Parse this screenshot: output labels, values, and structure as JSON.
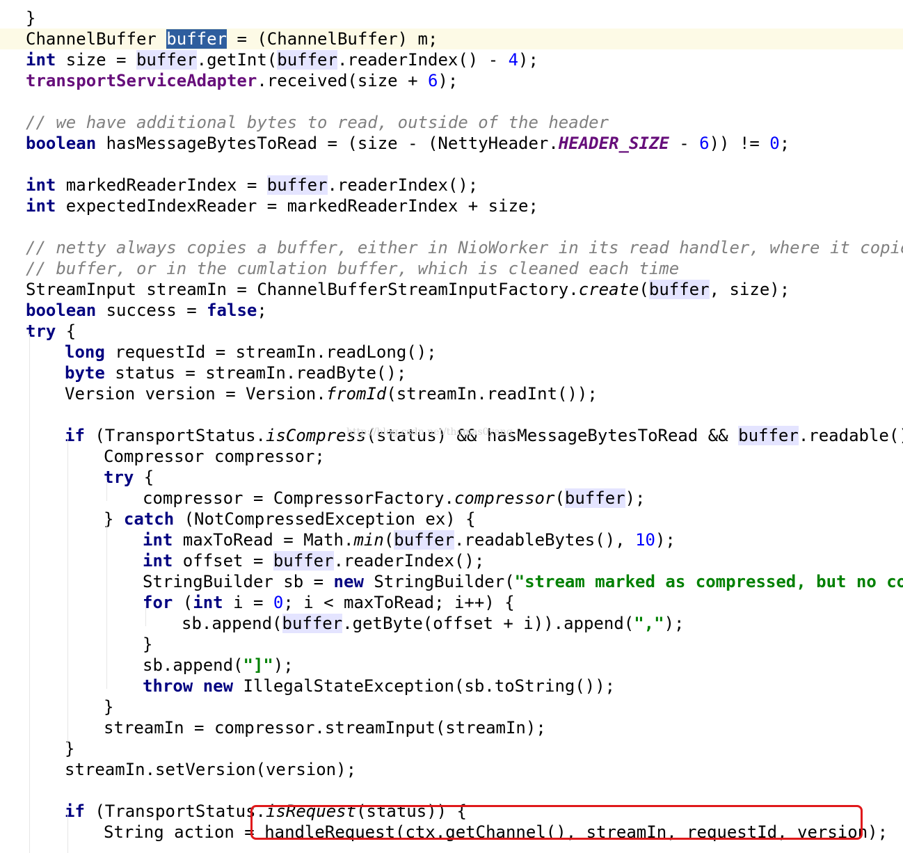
{
  "code_lines": [
    {
      "indent": 0,
      "tokens": [
        {
          "t": "}",
          "c": ""
        }
      ]
    },
    {
      "indent": 0,
      "current": true,
      "tokens": [
        {
          "t": "ChannelBuffer ",
          "c": ""
        },
        {
          "t": "buffer",
          "c": "sel"
        },
        {
          "t": " = (ChannelBuffer) m;",
          "c": ""
        }
      ]
    },
    {
      "indent": 0,
      "tokens": [
        {
          "t": "int",
          "c": "k"
        },
        {
          "t": " size = ",
          "c": ""
        },
        {
          "t": "buffer",
          "c": "h"
        },
        {
          "t": ".getInt(",
          "c": ""
        },
        {
          "t": "buffer",
          "c": "h"
        },
        {
          "t": ".readerIndex() - ",
          "c": ""
        },
        {
          "t": "4",
          "c": "n"
        },
        {
          "t": ");",
          "c": ""
        }
      ]
    },
    {
      "indent": 0,
      "tokens": [
        {
          "t": "transportServiceAdapter",
          "c": "f"
        },
        {
          "t": ".received(size + ",
          "c": ""
        },
        {
          "t": "6",
          "c": "n"
        },
        {
          "t": ");",
          "c": ""
        }
      ]
    },
    {
      "indent": 0,
      "tokens": []
    },
    {
      "indent": 0,
      "tokens": [
        {
          "t": "// we have additional bytes to read, outside of the header",
          "c": "c"
        }
      ]
    },
    {
      "indent": 0,
      "tokens": [
        {
          "t": "boolean",
          "c": "k"
        },
        {
          "t": " hasMessageBytesToRead = (size - (NettyHeader.",
          "c": ""
        },
        {
          "t": "HEADER_SIZE",
          "c": "sf"
        },
        {
          "t": " - ",
          "c": ""
        },
        {
          "t": "6",
          "c": "n"
        },
        {
          "t": ")) != ",
          "c": ""
        },
        {
          "t": "0",
          "c": "n"
        },
        {
          "t": ";",
          "c": ""
        }
      ]
    },
    {
      "indent": 0,
      "tokens": []
    },
    {
      "indent": 0,
      "tokens": [
        {
          "t": "int",
          "c": "k"
        },
        {
          "t": " markedReaderIndex = ",
          "c": ""
        },
        {
          "t": "buffer",
          "c": "h"
        },
        {
          "t": ".readerIndex();",
          "c": ""
        }
      ]
    },
    {
      "indent": 0,
      "tokens": [
        {
          "t": "int",
          "c": "k"
        },
        {
          "t": " expectedIndexReader = markedReaderIndex + size;",
          "c": ""
        }
      ]
    },
    {
      "indent": 0,
      "tokens": []
    },
    {
      "indent": 0,
      "tokens": [
        {
          "t": "// netty always copies a buffer, either in NioWorker in its read handler, where it copies",
          "c": "c"
        }
      ]
    },
    {
      "indent": 0,
      "tokens": [
        {
          "t": "// buffer, or in the cumlation buffer, which is cleaned each time",
          "c": "c"
        }
      ]
    },
    {
      "indent": 0,
      "tokens": [
        {
          "t": "StreamInput streamIn = ChannelBufferStreamInputFactory.",
          "c": ""
        },
        {
          "t": "create",
          "c": "i"
        },
        {
          "t": "(",
          "c": ""
        },
        {
          "t": "buffer",
          "c": "h"
        },
        {
          "t": ", size);",
          "c": ""
        }
      ]
    },
    {
      "indent": 0,
      "tokens": [
        {
          "t": "boolean",
          "c": "k"
        },
        {
          "t": " success = ",
          "c": ""
        },
        {
          "t": "false",
          "c": "k"
        },
        {
          "t": ";",
          "c": ""
        }
      ]
    },
    {
      "indent": 0,
      "tokens": [
        {
          "t": "try",
          "c": "k"
        },
        {
          "t": " {",
          "c": ""
        }
      ]
    },
    {
      "indent": 1,
      "tokens": [
        {
          "t": "long",
          "c": "k"
        },
        {
          "t": " requestId = streamIn.readLong();",
          "c": ""
        }
      ]
    },
    {
      "indent": 1,
      "tokens": [
        {
          "t": "byte",
          "c": "k"
        },
        {
          "t": " status = streamIn.readByte();",
          "c": ""
        }
      ]
    },
    {
      "indent": 1,
      "tokens": [
        {
          "t": "Version version = Version.",
          "c": ""
        },
        {
          "t": "fromId",
          "c": "i"
        },
        {
          "t": "(streamIn.readInt());",
          "c": ""
        }
      ]
    },
    {
      "indent": 1,
      "tokens": []
    },
    {
      "indent": 1,
      "tokens": [
        {
          "t": "if",
          "c": "k"
        },
        {
          "t": " (TransportStatus.",
          "c": ""
        },
        {
          "t": "isCompress",
          "c": "i"
        },
        {
          "t": "(status) && hasMessageBytesToRead && ",
          "c": ""
        },
        {
          "t": "buffer",
          "c": "h"
        },
        {
          "t": ".readable()) {",
          "c": ""
        }
      ]
    },
    {
      "indent": 2,
      "tokens": [
        {
          "t": "Compressor compressor;",
          "c": ""
        }
      ]
    },
    {
      "indent": 2,
      "tokens": [
        {
          "t": "try",
          "c": "k"
        },
        {
          "t": " {",
          "c": ""
        }
      ]
    },
    {
      "indent": 3,
      "tokens": [
        {
          "t": "compressor = CompressorFactory.",
          "c": ""
        },
        {
          "t": "compressor",
          "c": "i"
        },
        {
          "t": "(",
          "c": ""
        },
        {
          "t": "buffer",
          "c": "h"
        },
        {
          "t": ");",
          "c": ""
        }
      ]
    },
    {
      "indent": 2,
      "tokens": [
        {
          "t": "} ",
          "c": ""
        },
        {
          "t": "catch",
          "c": "k"
        },
        {
          "t": " (NotCompressedException ex) {",
          "c": ""
        }
      ]
    },
    {
      "indent": 3,
      "tokens": [
        {
          "t": "int",
          "c": "k"
        },
        {
          "t": " maxToRead = Math.",
          "c": ""
        },
        {
          "t": "min",
          "c": "i"
        },
        {
          "t": "(",
          "c": ""
        },
        {
          "t": "buffer",
          "c": "h"
        },
        {
          "t": ".readableBytes(), ",
          "c": ""
        },
        {
          "t": "10",
          "c": "n"
        },
        {
          "t": ");",
          "c": ""
        }
      ]
    },
    {
      "indent": 3,
      "tokens": [
        {
          "t": "int",
          "c": "k"
        },
        {
          "t": " offset = ",
          "c": ""
        },
        {
          "t": "buffer",
          "c": "h"
        },
        {
          "t": ".readerIndex();",
          "c": ""
        }
      ]
    },
    {
      "indent": 3,
      "tokens": [
        {
          "t": "StringBuilder sb = ",
          "c": ""
        },
        {
          "t": "new",
          "c": "k"
        },
        {
          "t": " StringBuilder(",
          "c": ""
        },
        {
          "t": "\"stream marked as compressed, but no comp",
          "c": "s"
        }
      ]
    },
    {
      "indent": 3,
      "tokens": [
        {
          "t": "for",
          "c": "k"
        },
        {
          "t": " (",
          "c": ""
        },
        {
          "t": "int",
          "c": "k"
        },
        {
          "t": " i = ",
          "c": ""
        },
        {
          "t": "0",
          "c": "n"
        },
        {
          "t": "; i < maxToRead; i++) {",
          "c": ""
        }
      ]
    },
    {
      "indent": 4,
      "tokens": [
        {
          "t": "sb.append(",
          "c": ""
        },
        {
          "t": "buffer",
          "c": "h"
        },
        {
          "t": ".getByte(offset + i)).append(",
          "c": ""
        },
        {
          "t": "\",\"",
          "c": "s"
        },
        {
          "t": ");",
          "c": ""
        }
      ]
    },
    {
      "indent": 3,
      "tokens": [
        {
          "t": "}",
          "c": ""
        }
      ]
    },
    {
      "indent": 3,
      "tokens": [
        {
          "t": "sb.append(",
          "c": ""
        },
        {
          "t": "\"]\"",
          "c": "s"
        },
        {
          "t": ");",
          "c": ""
        }
      ]
    },
    {
      "indent": 3,
      "tokens": [
        {
          "t": "throw",
          "c": "k"
        },
        {
          "t": " ",
          "c": ""
        },
        {
          "t": "new",
          "c": "k"
        },
        {
          "t": " IllegalStateException(sb.toString());",
          "c": ""
        }
      ]
    },
    {
      "indent": 2,
      "tokens": [
        {
          "t": "}",
          "c": ""
        }
      ]
    },
    {
      "indent": 2,
      "tokens": [
        {
          "t": "streamIn = compressor.streamInput(streamIn);",
          "c": ""
        }
      ]
    },
    {
      "indent": 1,
      "tokens": [
        {
          "t": "}",
          "c": ""
        }
      ]
    },
    {
      "indent": 1,
      "tokens": [
        {
          "t": "streamIn.setVersion(version);",
          "c": ""
        }
      ]
    },
    {
      "indent": 1,
      "tokens": []
    },
    {
      "indent": 1,
      "tokens": [
        {
          "t": "if",
          "c": "k"
        },
        {
          "t": " (TransportStatus.",
          "c": ""
        },
        {
          "t": "isRequest",
          "c": "i"
        },
        {
          "t": "(status)) {",
          "c": ""
        }
      ]
    },
    {
      "indent": 2,
      "tokens": [
        {
          "t": "String action = handleRequest(ctx.getChannel(), streamIn, requestId, version);",
          "c": ""
        }
      ]
    }
  ],
  "watermark": "http://blog.csdn.net/thomas0yang",
  "colors": {
    "keyword": "#000080",
    "field": "#660e7a",
    "number": "#0000ff",
    "string": "#008000",
    "comment": "#808080",
    "usage_highlight": "#e4e4ff",
    "selection": "#2e5e9e",
    "current_line": "#fdfae6",
    "callout_border": "#e0191b"
  }
}
